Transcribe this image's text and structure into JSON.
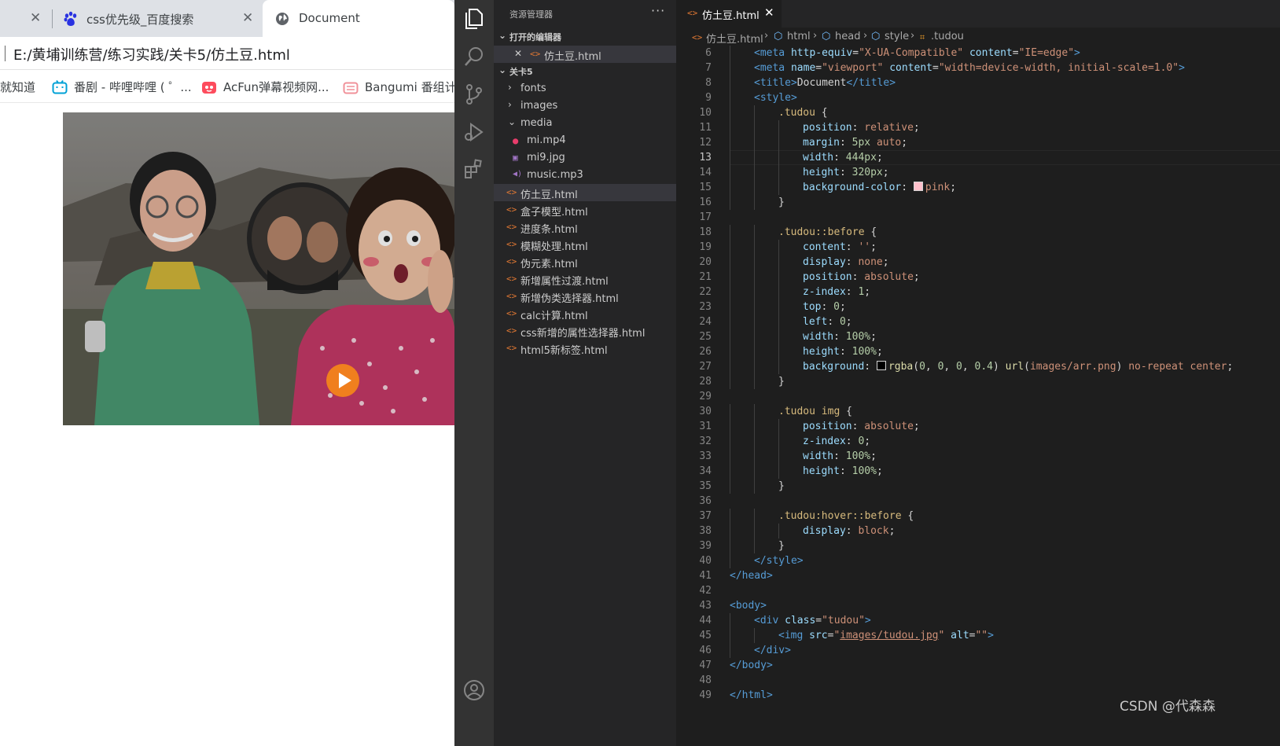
{
  "browser": {
    "tabs": [
      {
        "title": "",
        "close": "✕"
      },
      {
        "title": "css优先级_百度搜索",
        "close": "✕"
      },
      {
        "title": "Document"
      }
    ],
    "address": "E:/黄埔训练营/练习实践/关卡5/仿土豆.html",
    "bookmarks": [
      {
        "label": "就知道"
      },
      {
        "label": "番剧 - 哔哩哔哩 ( ゜..."
      },
      {
        "label": "AcFun弹幕视频网..."
      },
      {
        "label": "Bangumi 番组计"
      }
    ]
  },
  "vscode": {
    "explorer_title": "资源管理器",
    "more": "···",
    "open_editors_label": "打开的编辑器",
    "open_editor_file": "仿土豆.html",
    "folder_label": "关卡5",
    "tree": [
      {
        "label": "fonts",
        "kind": "folder",
        "expanded": false
      },
      {
        "label": "images",
        "kind": "folder",
        "expanded": false
      },
      {
        "label": "media",
        "kind": "folder",
        "expanded": true
      },
      {
        "label": "mi.mp4",
        "kind": "video"
      },
      {
        "label": "mi9.jpg",
        "kind": "image"
      },
      {
        "label": "music.mp3",
        "kind": "audio"
      },
      {
        "label": "仿土豆.html",
        "kind": "html",
        "selected": true
      },
      {
        "label": "盒子模型.html",
        "kind": "html"
      },
      {
        "label": "进度条.html",
        "kind": "html"
      },
      {
        "label": "模糊处理.html",
        "kind": "html"
      },
      {
        "label": "伪元素.html",
        "kind": "html"
      },
      {
        "label": "新增属性过渡.html",
        "kind": "html"
      },
      {
        "label": "新增伪类选择器.html",
        "kind": "html"
      },
      {
        "label": "calc计算.html",
        "kind": "html"
      },
      {
        "label": "css新增的属性选择器.html",
        "kind": "html"
      },
      {
        "label": "html5新标签.html",
        "kind": "html"
      }
    ],
    "editor_tab": "仿土豆.html",
    "editor_tab_close": "✕",
    "breadcrumbs": [
      "仿土豆.html",
      "html",
      "head",
      "style",
      ".tudou"
    ],
    "current_line": 13,
    "code": [
      {
        "n": 6,
        "i": 1,
        "tokens": [
          [
            "t",
            "<meta "
          ],
          [
            "a",
            "http-equiv"
          ],
          [
            "d",
            "="
          ],
          [
            "s",
            "\"X-UA-Compatible\""
          ],
          [
            "d",
            " "
          ],
          [
            "a",
            "content"
          ],
          [
            "d",
            "="
          ],
          [
            "s",
            "\"IE=edge\""
          ],
          [
            "t",
            ">"
          ]
        ]
      },
      {
        "n": 7,
        "i": 1,
        "tokens": [
          [
            "t",
            "<meta "
          ],
          [
            "a",
            "name"
          ],
          [
            "d",
            "="
          ],
          [
            "s",
            "\"viewport\""
          ],
          [
            "d",
            " "
          ],
          [
            "a",
            "content"
          ],
          [
            "d",
            "="
          ],
          [
            "s",
            "\"width=device-width, initial-scale=1.0\""
          ],
          [
            "t",
            ">"
          ]
        ]
      },
      {
        "n": 8,
        "i": 1,
        "tokens": [
          [
            "t",
            "<title>"
          ],
          [
            "tx",
            "Document"
          ],
          [
            "t",
            "</title>"
          ]
        ]
      },
      {
        "n": 9,
        "i": 1,
        "tokens": [
          [
            "t",
            "<style>"
          ]
        ]
      },
      {
        "n": 10,
        "i": 2,
        "tokens": [
          [
            "sel",
            ".tudou"
          ],
          [
            "d",
            " {"
          ]
        ]
      },
      {
        "n": 11,
        "i": 3,
        "tokens": [
          [
            "pr",
            "position"
          ],
          [
            "d",
            ": "
          ],
          [
            "v",
            "relative"
          ],
          [
            "d",
            ";"
          ]
        ]
      },
      {
        "n": 12,
        "i": 3,
        "tokens": [
          [
            "pr",
            "margin"
          ],
          [
            "d",
            ": "
          ],
          [
            "n",
            "5px"
          ],
          [
            "d",
            " "
          ],
          [
            "v",
            "auto"
          ],
          [
            "d",
            ";"
          ]
        ]
      },
      {
        "n": 13,
        "i": 3,
        "tokens": [
          [
            "pr",
            "width"
          ],
          [
            "d",
            ": "
          ],
          [
            "n",
            "444px"
          ],
          [
            "d",
            ";"
          ]
        ]
      },
      {
        "n": 14,
        "i": 3,
        "tokens": [
          [
            "pr",
            "height"
          ],
          [
            "d",
            ": "
          ],
          [
            "n",
            "320px"
          ],
          [
            "d",
            ";"
          ]
        ]
      },
      {
        "n": 15,
        "i": 3,
        "tokens": [
          [
            "pr",
            "background-color"
          ],
          [
            "d",
            ": "
          ],
          [
            "swatch",
            "#ffc0cb"
          ],
          [
            "v",
            "pink"
          ],
          [
            "d",
            ";"
          ]
        ]
      },
      {
        "n": 16,
        "i": 2,
        "tokens": [
          [
            "d",
            "}"
          ]
        ]
      },
      {
        "n": 17,
        "i": 0,
        "tokens": []
      },
      {
        "n": 18,
        "i": 2,
        "tokens": [
          [
            "sel",
            ".tudou::before"
          ],
          [
            "d",
            " {"
          ]
        ]
      },
      {
        "n": 19,
        "i": 3,
        "tokens": [
          [
            "pr",
            "content"
          ],
          [
            "d",
            ": "
          ],
          [
            "v",
            "''"
          ],
          [
            "d",
            ";"
          ]
        ]
      },
      {
        "n": 20,
        "i": 3,
        "tokens": [
          [
            "pr",
            "display"
          ],
          [
            "d",
            ": "
          ],
          [
            "v",
            "none"
          ],
          [
            "d",
            ";"
          ]
        ]
      },
      {
        "n": 21,
        "i": 3,
        "tokens": [
          [
            "pr",
            "position"
          ],
          [
            "d",
            ": "
          ],
          [
            "v",
            "absolute"
          ],
          [
            "d",
            ";"
          ]
        ]
      },
      {
        "n": 22,
        "i": 3,
        "tokens": [
          [
            "pr",
            "z-index"
          ],
          [
            "d",
            ": "
          ],
          [
            "n",
            "1"
          ],
          [
            "d",
            ";"
          ]
        ]
      },
      {
        "n": 23,
        "i": 3,
        "tokens": [
          [
            "pr",
            "top"
          ],
          [
            "d",
            ": "
          ],
          [
            "n",
            "0"
          ],
          [
            "d",
            ";"
          ]
        ]
      },
      {
        "n": 24,
        "i": 3,
        "tokens": [
          [
            "pr",
            "left"
          ],
          [
            "d",
            ": "
          ],
          [
            "n",
            "0"
          ],
          [
            "d",
            ";"
          ]
        ]
      },
      {
        "n": 25,
        "i": 3,
        "tokens": [
          [
            "pr",
            "width"
          ],
          [
            "d",
            ": "
          ],
          [
            "n",
            "100%"
          ],
          [
            "d",
            ";"
          ]
        ]
      },
      {
        "n": 26,
        "i": 3,
        "tokens": [
          [
            "pr",
            "height"
          ],
          [
            "d",
            ": "
          ],
          [
            "n",
            "100%"
          ],
          [
            "d",
            ";"
          ]
        ]
      },
      {
        "n": 27,
        "i": 3,
        "tokens": [
          [
            "pr",
            "background"
          ],
          [
            "d",
            ": "
          ],
          [
            "swatch",
            "#000000"
          ],
          [
            "f",
            "rgba"
          ],
          [
            "d",
            "("
          ],
          [
            "n",
            "0"
          ],
          [
            "d",
            ", "
          ],
          [
            "n",
            "0"
          ],
          [
            "d",
            ", "
          ],
          [
            "n",
            "0"
          ],
          [
            "d",
            ", "
          ],
          [
            "n",
            "0.4"
          ],
          [
            "d",
            ") "
          ],
          [
            "f",
            "url"
          ],
          [
            "d",
            "("
          ],
          [
            "s",
            "images/arr.png"
          ],
          [
            "d",
            ") "
          ],
          [
            "v",
            "no-repeat"
          ],
          [
            "d",
            " "
          ],
          [
            "v",
            "center"
          ],
          [
            "d",
            ";"
          ]
        ]
      },
      {
        "n": 28,
        "i": 2,
        "tokens": [
          [
            "d",
            "}"
          ]
        ]
      },
      {
        "n": 29,
        "i": 0,
        "tokens": []
      },
      {
        "n": 30,
        "i": 2,
        "tokens": [
          [
            "sel",
            ".tudou img"
          ],
          [
            "d",
            " {"
          ]
        ]
      },
      {
        "n": 31,
        "i": 3,
        "tokens": [
          [
            "pr",
            "position"
          ],
          [
            "d",
            ": "
          ],
          [
            "v",
            "absolute"
          ],
          [
            "d",
            ";"
          ]
        ]
      },
      {
        "n": 32,
        "i": 3,
        "tokens": [
          [
            "pr",
            "z-index"
          ],
          [
            "d",
            ": "
          ],
          [
            "n",
            "0"
          ],
          [
            "d",
            ";"
          ]
        ]
      },
      {
        "n": 33,
        "i": 3,
        "tokens": [
          [
            "pr",
            "width"
          ],
          [
            "d",
            ": "
          ],
          [
            "n",
            "100%"
          ],
          [
            "d",
            ";"
          ]
        ]
      },
      {
        "n": 34,
        "i": 3,
        "tokens": [
          [
            "pr",
            "height"
          ],
          [
            "d",
            ": "
          ],
          [
            "n",
            "100%"
          ],
          [
            "d",
            ";"
          ]
        ]
      },
      {
        "n": 35,
        "i": 2,
        "tokens": [
          [
            "d",
            "}"
          ]
        ]
      },
      {
        "n": 36,
        "i": 0,
        "tokens": []
      },
      {
        "n": 37,
        "i": 2,
        "tokens": [
          [
            "sel",
            ".tudou:hover::before"
          ],
          [
            "d",
            " {"
          ]
        ]
      },
      {
        "n": 38,
        "i": 3,
        "tokens": [
          [
            "pr",
            "display"
          ],
          [
            "d",
            ": "
          ],
          [
            "v",
            "block"
          ],
          [
            "d",
            ";"
          ]
        ]
      },
      {
        "n": 39,
        "i": 2,
        "tokens": [
          [
            "d",
            "}"
          ]
        ]
      },
      {
        "n": 40,
        "i": 1,
        "tokens": [
          [
            "t",
            "</style>"
          ]
        ]
      },
      {
        "n": 41,
        "i": 0,
        "tokens": [
          [
            "t",
            "</head>"
          ]
        ]
      },
      {
        "n": 42,
        "i": 0,
        "tokens": []
      },
      {
        "n": 43,
        "i": 0,
        "tokens": [
          [
            "t",
            "<body>"
          ]
        ]
      },
      {
        "n": 44,
        "i": 1,
        "tokens": [
          [
            "t",
            "<div "
          ],
          [
            "a",
            "class"
          ],
          [
            "d",
            "="
          ],
          [
            "s",
            "\"tudou\""
          ],
          [
            "t",
            ">"
          ]
        ]
      },
      {
        "n": 45,
        "i": 2,
        "tokens": [
          [
            "t",
            "<img "
          ],
          [
            "a",
            "src"
          ],
          [
            "d",
            "="
          ],
          [
            "s",
            "\""
          ],
          [
            "su",
            "images/tudou.jpg"
          ],
          [
            "s",
            "\""
          ],
          [
            "d",
            " "
          ],
          [
            "a",
            "alt"
          ],
          [
            "d",
            "="
          ],
          [
            "s",
            "\"\""
          ],
          [
            "t",
            ">"
          ]
        ]
      },
      {
        "n": 46,
        "i": 1,
        "tokens": [
          [
            "t",
            "</div>"
          ]
        ]
      },
      {
        "n": 47,
        "i": 0,
        "tokens": [
          [
            "t",
            "</body>"
          ]
        ]
      },
      {
        "n": 48,
        "i": 0,
        "tokens": []
      },
      {
        "n": 49,
        "i": 0,
        "tokens": [
          [
            "t",
            "</html>"
          ]
        ]
      }
    ]
  },
  "watermark": "CSDN @代森森"
}
